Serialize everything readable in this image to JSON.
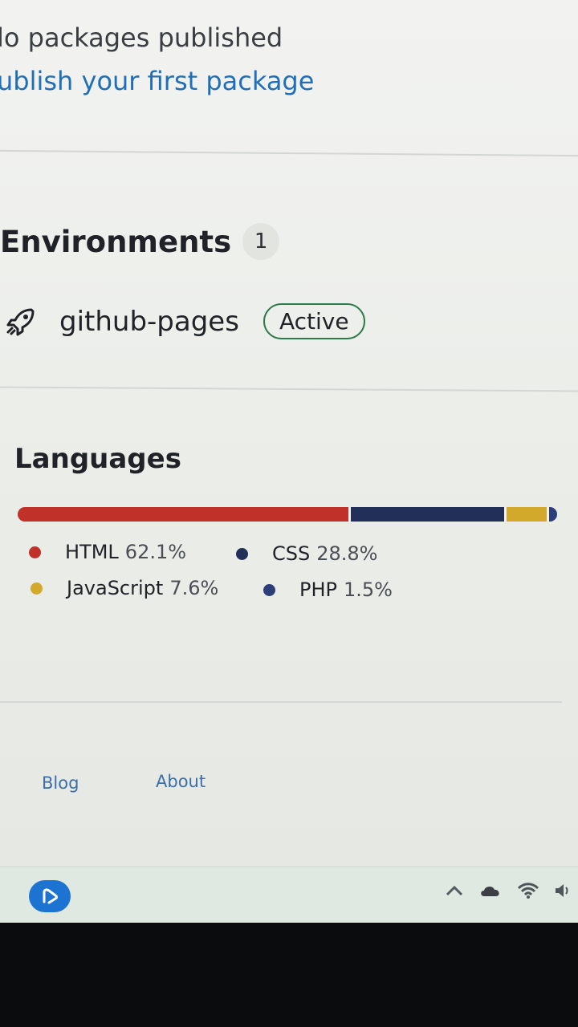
{
  "packages": {
    "title": "lo packages published",
    "link": "ublish your first package"
  },
  "environments": {
    "title": "Environments",
    "count": "1",
    "items": [
      {
        "name": "github-pages",
        "status": "Active",
        "icon": "rocket-icon"
      }
    ]
  },
  "languages": {
    "title": "Languages",
    "items": [
      {
        "name": "HTML",
        "percent": "62.1%",
        "value": 62.1,
        "color": "#c0312a"
      },
      {
        "name": "CSS",
        "percent": "28.8%",
        "value": 28.8,
        "color": "#223059"
      },
      {
        "name": "JavaScript",
        "percent": "7.6%",
        "value": 7.6,
        "color": "#d3a92b"
      },
      {
        "name": "PHP",
        "percent": "1.5%",
        "value": 1.5,
        "color": "#2c3e78"
      }
    ]
  },
  "footer": {
    "links": [
      "Blog",
      "About"
    ]
  },
  "taskbar": {
    "app_icon": "browser-icon",
    "tray_icons": [
      "chevron-up-icon",
      "cloud-icon",
      "wifi-icon",
      "speaker-icon"
    ]
  }
}
